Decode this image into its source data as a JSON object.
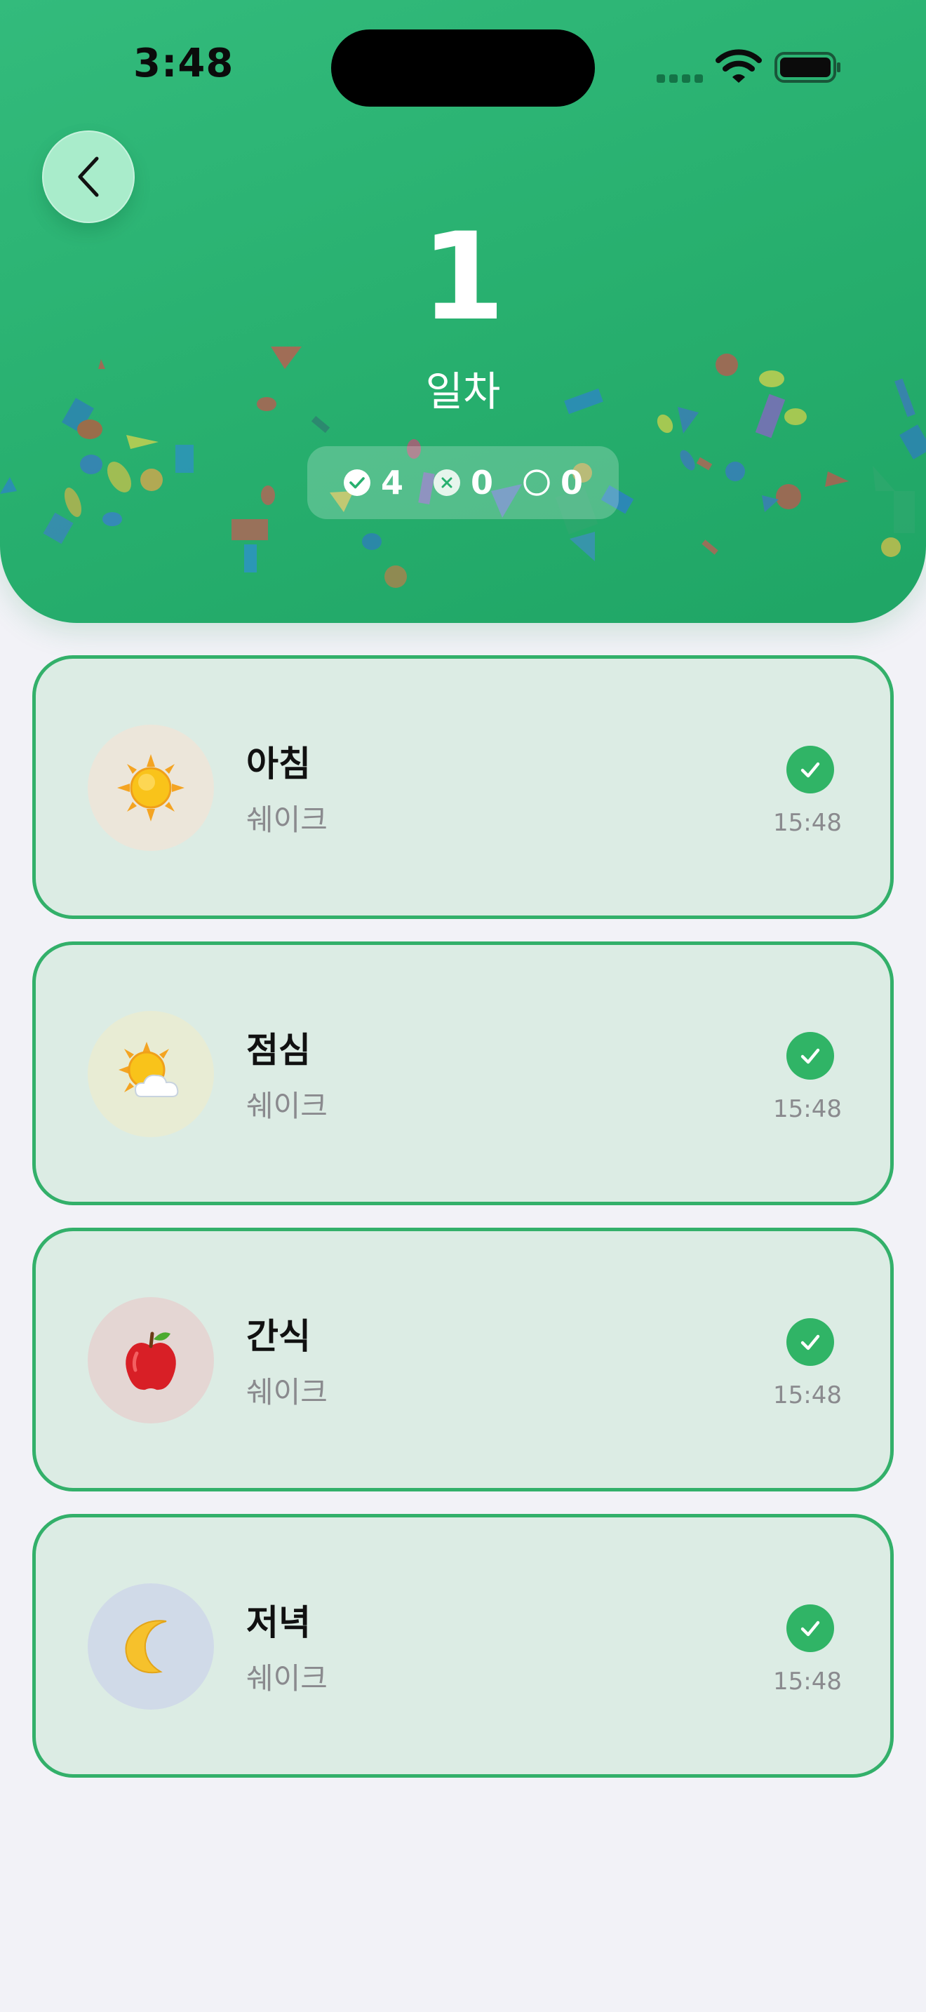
{
  "status_bar": {
    "time": "3:48",
    "icons": [
      "cellular-signal-icon",
      "wifi-icon",
      "battery-icon"
    ]
  },
  "header": {
    "back_icon": "chevron-left-icon",
    "day_number": "1",
    "day_label": "일차",
    "summary": {
      "completed": {
        "icon": "check-circle-icon",
        "count": "4"
      },
      "skipped": {
        "icon": "x-circle-icon",
        "count": "0"
      },
      "pending": {
        "icon": "empty-circle-icon",
        "count": "0"
      }
    }
  },
  "meals": [
    {
      "title": "아침",
      "subtitle": "쉐이크",
      "time": "15:48",
      "icon": "sun-icon",
      "icon_bg": "#ece6da",
      "status": "completed"
    },
    {
      "title": "점심",
      "subtitle": "쉐이크",
      "time": "15:48",
      "icon": "sun-behind-cloud-icon",
      "icon_bg": "#e8ecd4",
      "status": "completed"
    },
    {
      "title": "간식",
      "subtitle": "쉐이크",
      "time": "15:48",
      "icon": "apple-icon",
      "icon_bg": "#e4d6d3",
      "status": "completed"
    },
    {
      "title": "저녁",
      "subtitle": "쉐이크",
      "time": "15:48",
      "icon": "crescent-moon-icon",
      "icon_bg": "#d0dae8",
      "status": "completed"
    }
  ],
  "colors": {
    "header_green": "#28b06f",
    "card_background": "#dcece4",
    "card_border": "#33b06a",
    "check_green": "#30b466",
    "page_background": "#f2f2f7"
  }
}
